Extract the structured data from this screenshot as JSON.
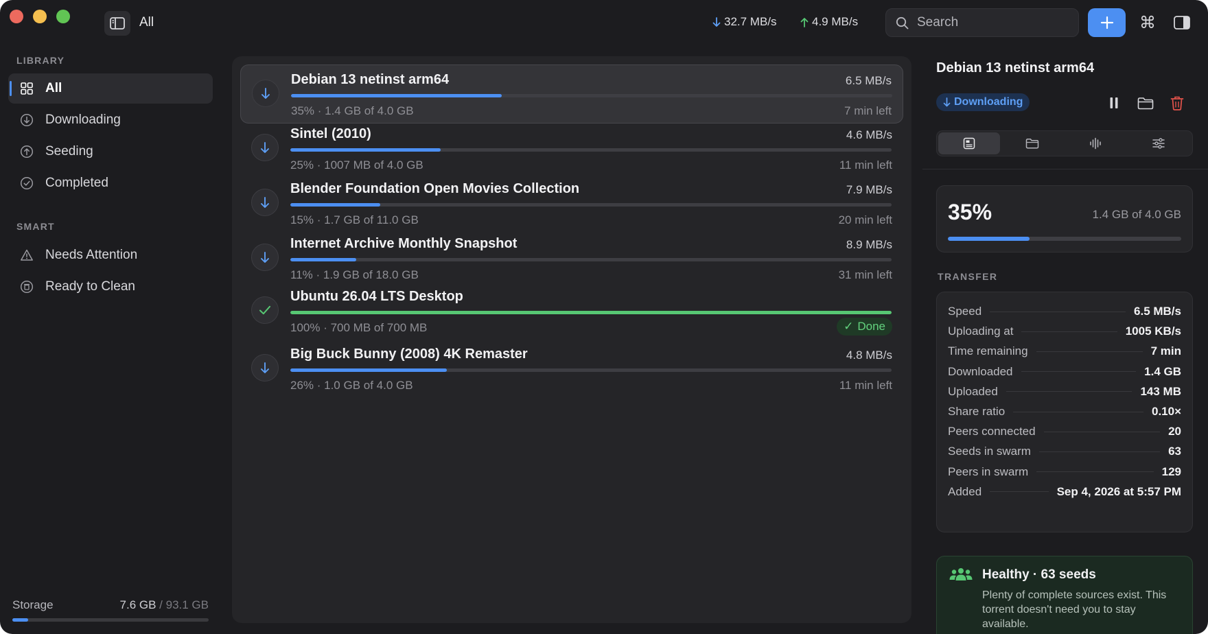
{
  "toolbar": {
    "title": "All",
    "download_rate": "32.7 MB/s",
    "upload_rate": "4.9 MB/s",
    "search_placeholder": "Search"
  },
  "sidebar": {
    "library_title": "LIBRARY",
    "library_items": [
      {
        "label": "All",
        "icon": "grid-icon",
        "active": true
      },
      {
        "label": "Downloading",
        "icon": "arrow-down-circle-icon"
      },
      {
        "label": "Seeding",
        "icon": "arrow-up-circle-icon"
      },
      {
        "label": "Completed",
        "icon": "checkmark-circle-icon"
      }
    ],
    "smart_title": "SMART",
    "smart_items": [
      {
        "label": "Needs Attention",
        "icon": "warning-triangle-icon"
      },
      {
        "label": "Ready to Clean",
        "icon": "trash-circle-icon"
      }
    ],
    "storage": {
      "label": "Storage",
      "used": "7.6 GB",
      "total": "/ 93.1 GB",
      "used_fraction": 0.082
    }
  },
  "torrents": [
    {
      "name": "Debian 13 netinst arm64",
      "speed": "6.5 MB/s",
      "detail": "35% · 1.4 GB of 4.0 GB",
      "eta": "7 min left",
      "progress": 35,
      "state": "downloading",
      "selected": true
    },
    {
      "name": "Sintel (2010)",
      "speed": "4.6 MB/s",
      "detail": "25% · 1007 MB of 4.0 GB",
      "eta": "11 min left",
      "progress": 25,
      "state": "downloading"
    },
    {
      "name": "Blender Foundation Open Movies Collection",
      "speed": "7.9 MB/s",
      "detail": "15% · 1.7 GB of 11.0 GB",
      "eta": "20 min left",
      "progress": 15,
      "state": "downloading"
    },
    {
      "name": "Internet Archive Monthly Snapshot",
      "speed": "8.9 MB/s",
      "detail": "11% · 1.9 GB of 18.0 GB",
      "eta": "31 min left",
      "progress": 11,
      "state": "downloading"
    },
    {
      "name": "Ubuntu 26.04 LTS Desktop",
      "speed": "",
      "detail": "100% · 700 MB of 700 MB",
      "eta": "Done",
      "progress": 100,
      "state": "done"
    },
    {
      "name": "Big Buck Bunny (2008) 4K Remaster",
      "speed": "4.8 MB/s",
      "detail": "26% · 1.0 GB of 4.0 GB",
      "eta": "11 min left",
      "progress": 26,
      "state": "downloading"
    }
  ],
  "inspector": {
    "title": "Debian 13 netinst arm64",
    "status": "Downloading",
    "percent": "35%",
    "percent_value": 35,
    "size": "1.4 GB of 4.0 GB",
    "transfer_title": "TRANSFER",
    "stats": [
      {
        "label": "Speed",
        "value": "6.5 MB/s"
      },
      {
        "label": "Uploading at",
        "value": "1005 KB/s"
      },
      {
        "label": "Time remaining",
        "value": "7 min"
      },
      {
        "label": "Downloaded",
        "value": "1.4 GB"
      },
      {
        "label": "Uploaded",
        "value": "143 MB"
      },
      {
        "label": "Share ratio",
        "value": "0.10×"
      },
      {
        "label": "Peers connected",
        "value": "20"
      },
      {
        "label": "Seeds in swarm",
        "value": "63"
      },
      {
        "label": "Peers in swarm",
        "value": "129"
      },
      {
        "label": "Added",
        "value": "Sep 4, 2026 at 5:57 PM"
      }
    ],
    "health": {
      "title": "Healthy · 63 seeds",
      "body": "Plenty of complete sources exist. This torrent doesn't need you to stay available."
    }
  },
  "colors": {
    "accent": "#4c8ff2",
    "success": "#57c773",
    "danger": "#e5534b"
  }
}
